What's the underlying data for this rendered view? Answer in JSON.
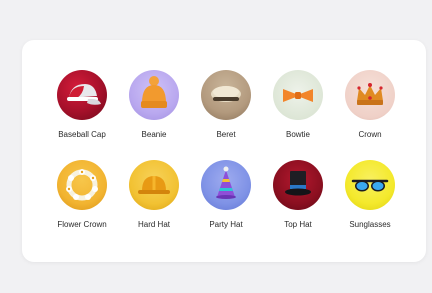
{
  "items": [
    {
      "label": "Baseball Cap",
      "icon": "baseball-cap-icon",
      "bg": "#a5102a"
    },
    {
      "label": "Beanie",
      "icon": "beanie-icon",
      "bg": "#b9a8ef"
    },
    {
      "label": "Beret",
      "icon": "beret-icon",
      "bg": "#b39a7e"
    },
    {
      "label": "Bowtie",
      "icon": "bowtie-icon",
      "bg": "#dde6d6"
    },
    {
      "label": "Crown",
      "icon": "crown-icon",
      "bg": "#efd0c7"
    },
    {
      "label": "Flower Crown",
      "icon": "flower-crown-icon",
      "bg": "#f2b431"
    },
    {
      "label": "Hard Hat",
      "icon": "hard-hat-icon",
      "bg": "#f2c233"
    },
    {
      "label": "Party Hat",
      "icon": "party-hat-icon",
      "bg": "#7f92e6"
    },
    {
      "label": "Top Hat",
      "icon": "top-hat-icon",
      "bg": "#8b0f20"
    },
    {
      "label": "Sunglasses",
      "icon": "sunglasses-icon",
      "bg": "#f4e92c"
    }
  ]
}
